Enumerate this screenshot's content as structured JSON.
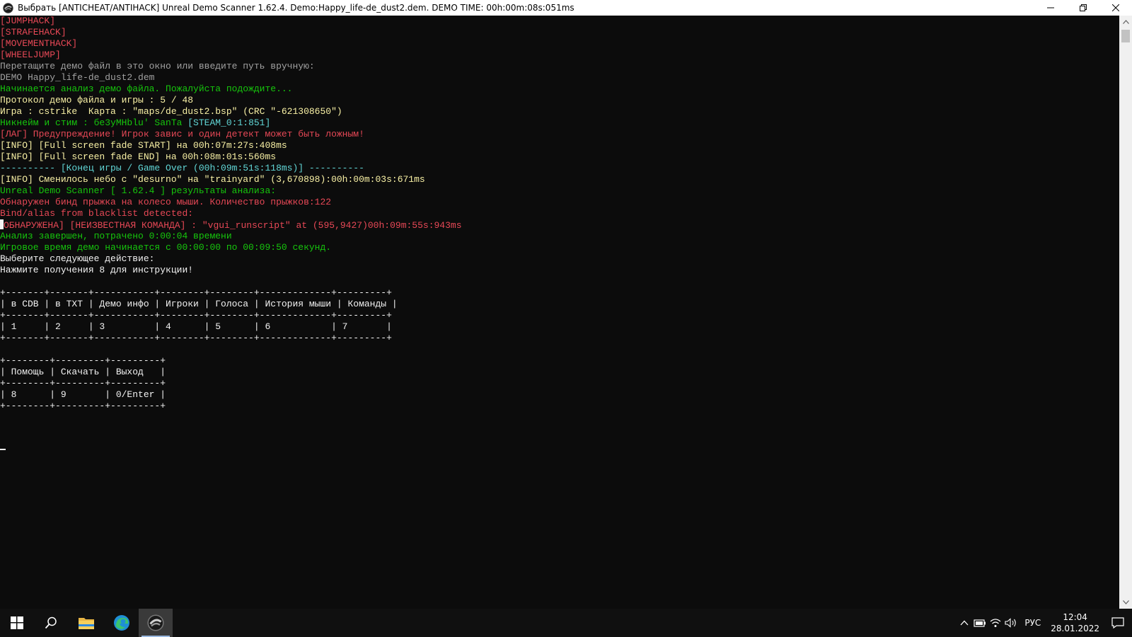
{
  "window": {
    "title": "Выбрать [ANTICHEAT/ANTIHACK] Unreal Demo Scanner 1.62.4. Demo:Happy_life-de_dust2.dem. DEMO TIME: 00h:00m:08s:051ms",
    "app_icon": "scanner-app-icon"
  },
  "console": {
    "lines": [
      {
        "t": "[JUMPHACK]",
        "c": "red"
      },
      {
        "t": "[STRAFEHACK]",
        "c": "red"
      },
      {
        "t": "[MOVEMENTHACK]",
        "c": "red"
      },
      {
        "t": "[WHEELJUMP]",
        "c": "red"
      },
      {
        "t": "Перетащите демо файл в это окно или введите путь вручную:",
        "c": "gray"
      },
      {
        "t": "DEMO Happy_life-de_dust2.dem",
        "c": "gray"
      },
      {
        "t": "Начинается анализ демо файла. Пожалуйста подождите...",
        "c": "green"
      },
      {
        "t": "Протокол демо файла и игры : 5 / 48",
        "c": "yellow"
      },
      {
        "t": "Игра : cstrike  Карта : \"maps/de_dust2.bsp\" (CRC \"-621308650\")",
        "c": "yellow"
      },
      {
        "t": "Никнейм и стим : бe3yMHblu' SanTa ",
        "c": "green",
        "t2": "[STEAM_0:1:851]",
        "c2": "cyan"
      },
      {
        "t": "[ЛАГ] Предупреждение! Игрок завис и один детект может быть ложным!",
        "c": "red"
      },
      {
        "t": "[INFO] [Full screen fade START] на 00h:07m:27s:408ms",
        "c": "yellow"
      },
      {
        "t": "[INFO] [Full screen fade END] на 00h:08m:01s:560ms",
        "c": "yellow"
      },
      {
        "t": "---------- [Конец игры / Game Over (00h:09m:51s:118ms)] ----------",
        "c": "cyan"
      },
      {
        "t": "[INFO] Сменилось небо с \"desurno\" на \"trainyard\" (3,670898):00h:00m:03s:671ms",
        "c": "yellow"
      },
      {
        "t": "Unreal Demo Scanner [ 1.62.4 ] результаты анализа:",
        "c": "green"
      },
      {
        "t": "Обнаружен бинд прыжка на колесо мыши. Количество прыжков:122",
        "c": "red"
      },
      {
        "t": "Bind/alias from blacklist detected:",
        "c": "red"
      },
      {
        "t": "ОБНАРУЖЕНА] [НЕИЗВЕСТНАЯ КОМАНДА] : \"vgui_runscript\" at (595,9427)00h:09m:55s:943ms",
        "c": "red",
        "cursor": true
      },
      {
        "t": "Анализ завершен, потрачено 0:00:04 времени",
        "c": "green"
      },
      {
        "t": "Игровое время демо начинается с 00:00:00 по 00:09:50 секунд.",
        "c": "green"
      },
      {
        "t": "Выберите следующее действие:",
        "c": "white"
      },
      {
        "t": "Нажмите получения 8 для инструкции!",
        "c": "white"
      },
      {
        "t": "",
        "c": "white"
      },
      {
        "t": "+-------+-------+-----------+--------+--------+-------------+---------+",
        "c": "white"
      },
      {
        "t": "| в CDB | в TXT | Демо инфо | Игроки | Голоса | История мыши | Команды |",
        "c": "white"
      },
      {
        "t": "+-------+-------+-----------+--------+--------+-------------+---------+",
        "c": "white"
      },
      {
        "t": "| 1     | 2     | 3         | 4      | 5      | 6           | 7       |",
        "c": "white"
      },
      {
        "t": "+-------+-------+-----------+--------+--------+-------------+---------+",
        "c": "white"
      },
      {
        "t": "",
        "c": "white"
      },
      {
        "t": "+--------+---------+---------+",
        "c": "white"
      },
      {
        "t": "| Помощь | Скачать | Выход   |",
        "c": "white"
      },
      {
        "t": "+--------+---------+---------+",
        "c": "white"
      },
      {
        "t": "| 8      | 9       | 0/Enter |",
        "c": "white"
      },
      {
        "t": "+--------+---------+---------+",
        "c": "white"
      }
    ]
  },
  "taskbar": {
    "start_icon": "windows-start-icon",
    "search_icon": "search-icon",
    "apps": [
      {
        "name": "file-explorer-icon"
      },
      {
        "name": "edge-browser-icon"
      },
      {
        "name": "scanner-app-icon",
        "active": true
      }
    ],
    "tray": {
      "language": "РУС",
      "time": "12:04",
      "date": "28.01.2022"
    }
  },
  "colors": {
    "background": "#0c0c0c",
    "red": "#e74856",
    "green": "#16c60c",
    "yellow": "#f9f1a5",
    "cyan": "#61d6d6",
    "gray": "#a0a0a0",
    "white": "#f2f2f2"
  }
}
